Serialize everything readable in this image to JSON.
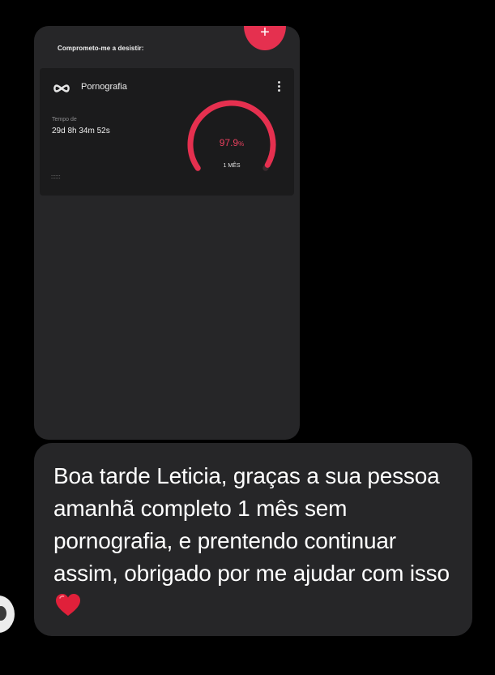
{
  "shared_screenshot": {
    "header_title": "Comprometo-me a desistir:",
    "fab_label": "+",
    "card": {
      "habit_name": "Pornografia",
      "icon": "infinity-icon",
      "time_label": "Tempo de",
      "time_value": "29d 8h 34m 52s",
      "progress_value": "97.9",
      "progress_unit": "%",
      "progress_fraction": 0.979,
      "goal_label": "1 MÊS",
      "accent_color": "#e5304f",
      "footer_icon": "::::::"
    }
  },
  "message": {
    "text": "Boa tarde Leticia, graças a sua pessoa amanhã completo 1 mês sem pornografia, e prentendo continuar assim, obrigado por me ajudar com isso",
    "trailing_emoji": "heart-icon"
  },
  "sender": {
    "avatar": "avatar"
  }
}
